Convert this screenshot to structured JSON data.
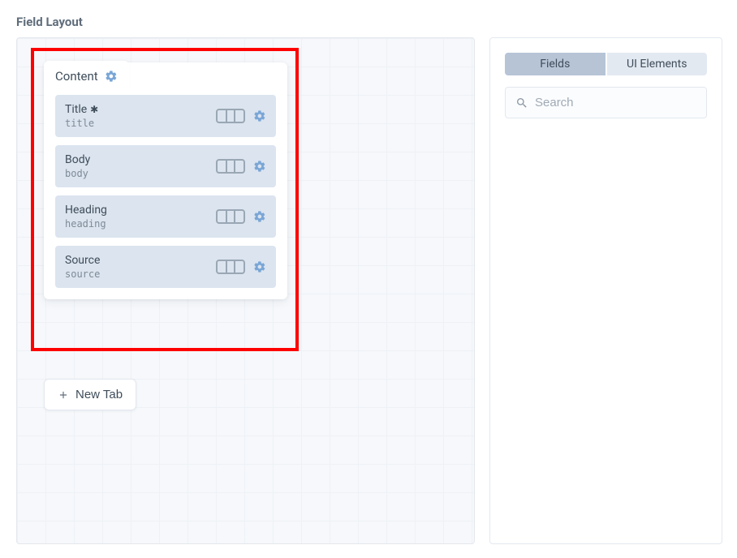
{
  "section_title": "Field Layout",
  "tab": {
    "name": "Content",
    "fields": [
      {
        "label": "Title",
        "handle": "title",
        "required": true
      },
      {
        "label": "Body",
        "handle": "body",
        "required": false
      },
      {
        "label": "Heading",
        "handle": "heading",
        "required": false
      },
      {
        "label": "Source",
        "handle": "source",
        "required": false
      }
    ]
  },
  "new_tab_label": "New Tab",
  "sidebar": {
    "tabs": {
      "fields": "Fields",
      "ui_elements": "UI Elements",
      "active": "fields"
    },
    "search_placeholder": "Search"
  }
}
